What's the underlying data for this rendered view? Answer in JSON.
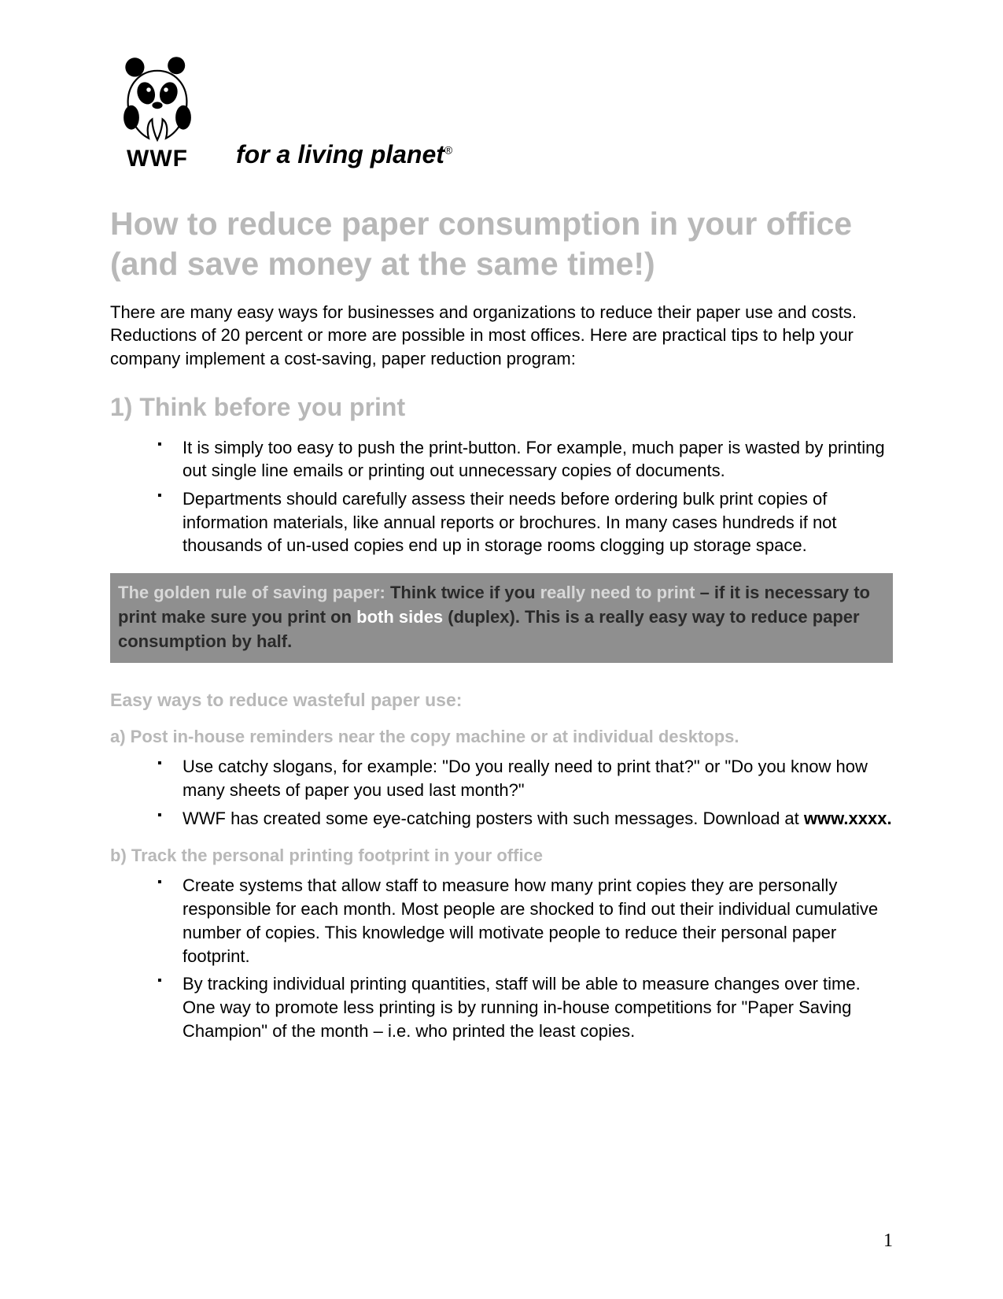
{
  "logo": {
    "org": "WWF",
    "tagline": "for a living planet",
    "regmark": "®",
    "icon_name": "panda-icon"
  },
  "title": "How to reduce paper consumption in your office (and save money at the same time!)",
  "intro": "There are many easy ways for businesses and organizations to reduce their paper use and costs. Reductions of 20 percent or more are possible in most offices. Here are practical tips to help your company implement a cost-saving, paper reduction program:",
  "section1": {
    "heading": "1) Think before you print",
    "bullets": [
      "It is simply too easy to push the print-button.  For example, much paper is wasted by printing out single line emails or printing out unnecessary copies of documents.",
      "Departments should carefully assess their needs before ordering bulk print copies of information materials, like annual reports or brochures.  In many cases hundreds if not thousands of un-used copies end up in storage rooms clogging up storage space."
    ],
    "callout": {
      "p1_muted": "The golden rule of saving paper: ",
      "p2_dark": "Think twice if you ",
      "p3_muted": "really need to print",
      "p4_dark": " – if it is necessary to print make sure you print on ",
      "p5_white": "both sides",
      "p6_dark": " (duplex). This is a really easy way to reduce paper consumption by half."
    },
    "subhead": "Easy ways to reduce wasteful paper use:",
    "sub_a": {
      "heading": "a) Post in-house reminders near the copy machine or at individual desktops.",
      "bullets": [
        {
          "pre": "Use catchy slogans, for example:  \"Do you really need to print that?\" or \"Do you know how many sheets of paper you used last month?\""
        },
        {
          "pre": "WWF has created some eye-catching posters with such messages. Download at ",
          "bold": "www.xxxx."
        }
      ]
    },
    "sub_b": {
      "heading": "b) Track the personal printing footprint in your office",
      "bullets": [
        "Create systems that allow staff to measure how many print copies they are personally responsible for each month. Most people are shocked to find out their individual cumulative number of copies. This knowledge will motivate people to reduce their personal paper footprint.",
        "By tracking individual printing quantities, staff will be able to measure changes over time. One way to promote less printing is by running in-house competitions for \"Paper Saving Champion\" of the month – i.e.  who printed the least copies."
      ]
    }
  },
  "page_number": "1"
}
